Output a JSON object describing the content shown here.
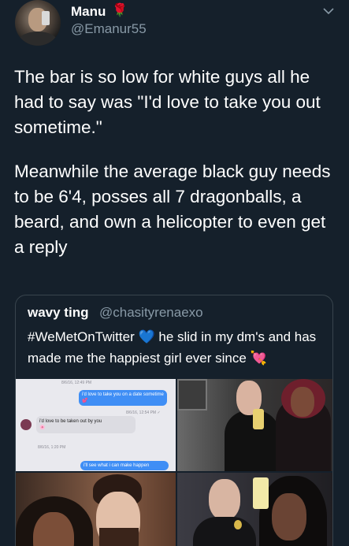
{
  "author": {
    "name": "Manu",
    "emoji": "🌹",
    "handle": "@Emanur55"
  },
  "tweet": {
    "paragraph1": "The bar is so low for white guys all he had to say was \"I'd love to take you out sometime.\"",
    "paragraph2": "Meanwhile the average black guy needs to be 6'4, posses all 7 dragonballs, a beard, and own a helicopter to even get a reply"
  },
  "quoted_tweet": {
    "name": "wavy ting",
    "handle": "@chasityrenaexo",
    "text_part1": "#WeMetOnTwitter",
    "heart1": "💙",
    "text_part2": " he slid in my dm's and has made me the happiest girl ever since ",
    "heart2": "💘"
  },
  "dm_screenshot": {
    "date1": "8/6/16, 12:49 PM",
    "message1": "i'd love to take you on a date sometime",
    "message1_emoji": "💕",
    "date2": "8/6/16, 12:54 PM ✓",
    "message2": "i'd love to be taken out by you",
    "message2_emoji": "🌸",
    "date3": "8/6/16, 1:20 PM",
    "message3": "i'll see what i can make happen"
  },
  "colors": {
    "background": "#15202b",
    "secondary_text": "#8899a6",
    "border": "#38444d",
    "dm_blue": "#3f8ef5"
  },
  "icons": {
    "menu": "chevron-down-icon"
  }
}
